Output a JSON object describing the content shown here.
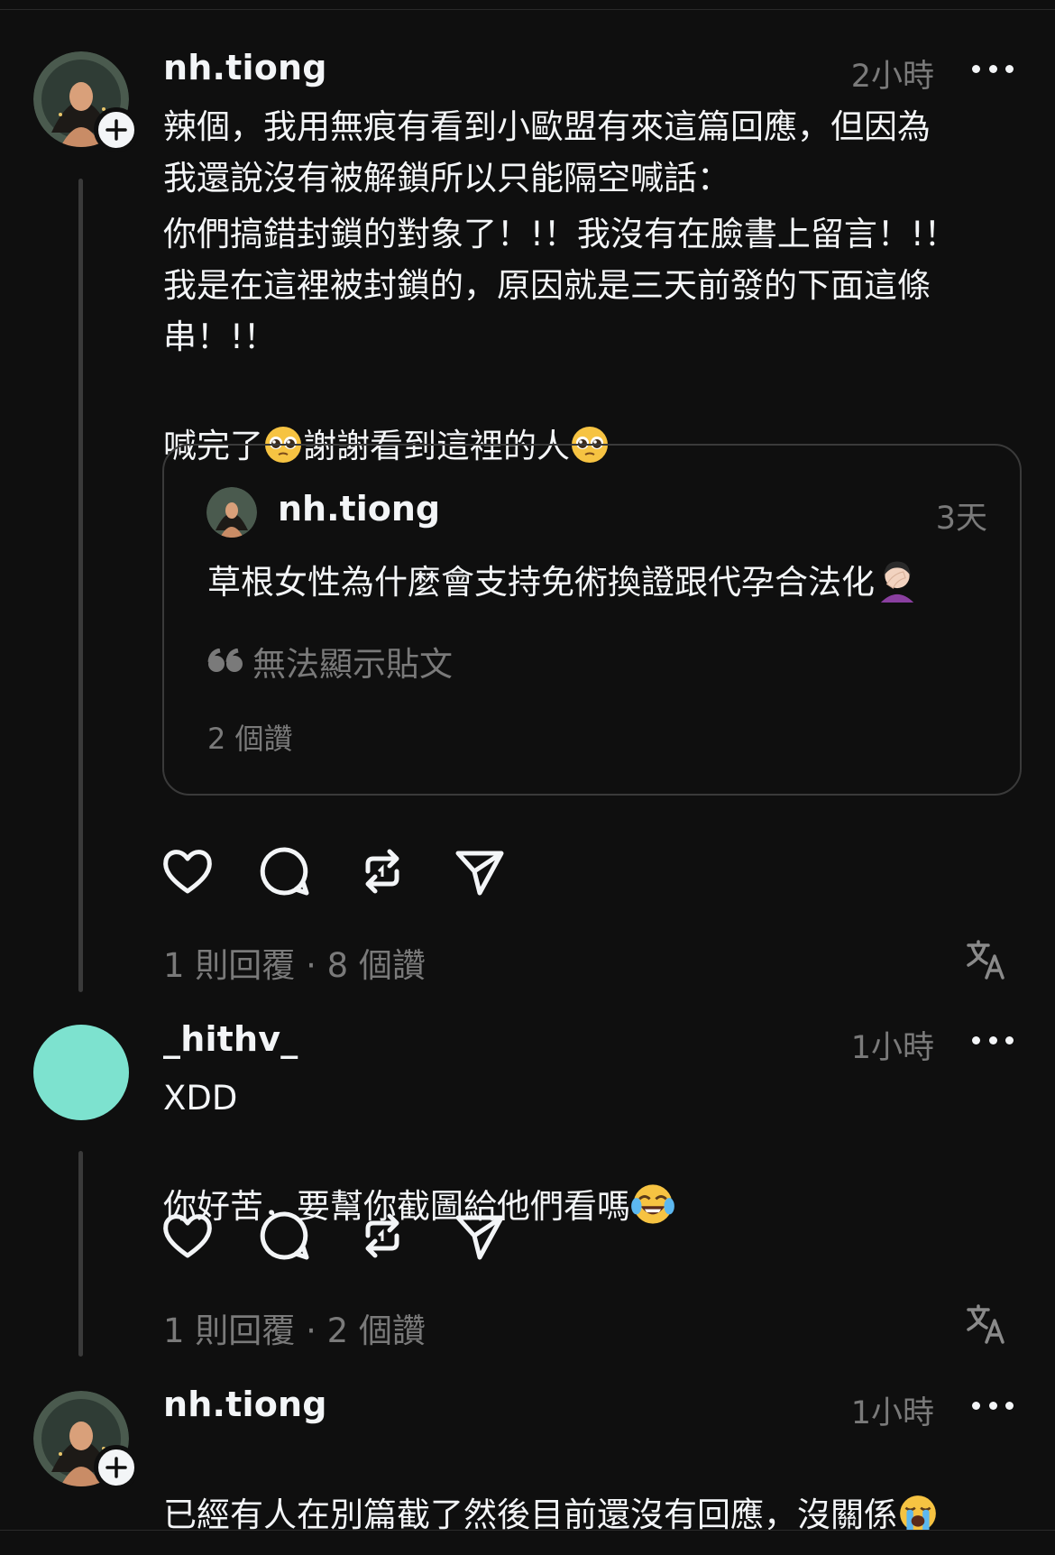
{
  "colors": {
    "background": "#0f0f0f",
    "text": "#f3f5f7",
    "secondary_text": "#7a7a7a",
    "border": "#3a3a3a",
    "avatar_teal": "#7de2cf"
  },
  "posts": [
    {
      "username": "nh.tiong",
      "time": "2小時",
      "text_lines": [
        "辣個，我用無痕有看到小歐盟有來這篇回應，但因為\n我還說沒有被解鎖所以只能隔空喊話：",
        "你們搞錯封鎖的對象了！!！我沒有在臉書上留言！!！\n我是在這裡被封鎖的，原因就是三天前發的下面這條\n串！!！",
        "喊完了",
        "謝謝看到這裡的人"
      ],
      "quote": {
        "username": "nh.tiong",
        "time": "3天",
        "text": "草根女性為什麼會支持免術換證跟代孕合法化",
        "unavailable": "無法顯示貼文",
        "likes": "2 個讚"
      },
      "meta": "1 則回覆 · 8 個讚"
    },
    {
      "username": "_hithv_",
      "time": "1小時",
      "text_lines": [
        "XDD",
        "你好苦，要幫你截圖給他們看嗎"
      ],
      "meta": "1 則回覆 · 2 個讚"
    },
    {
      "username": "nh.tiong",
      "time": "1小時",
      "text_lines": [
        "已經有人在別篇截了然後目前還沒有回應，沒關係"
      ]
    }
  ],
  "icons": {
    "like": "heart-icon",
    "reply": "comment-icon",
    "repost": "repost-icon",
    "share": "send-icon",
    "translate": "translate-icon",
    "more": "more-icon",
    "follow": "plus-icon"
  }
}
